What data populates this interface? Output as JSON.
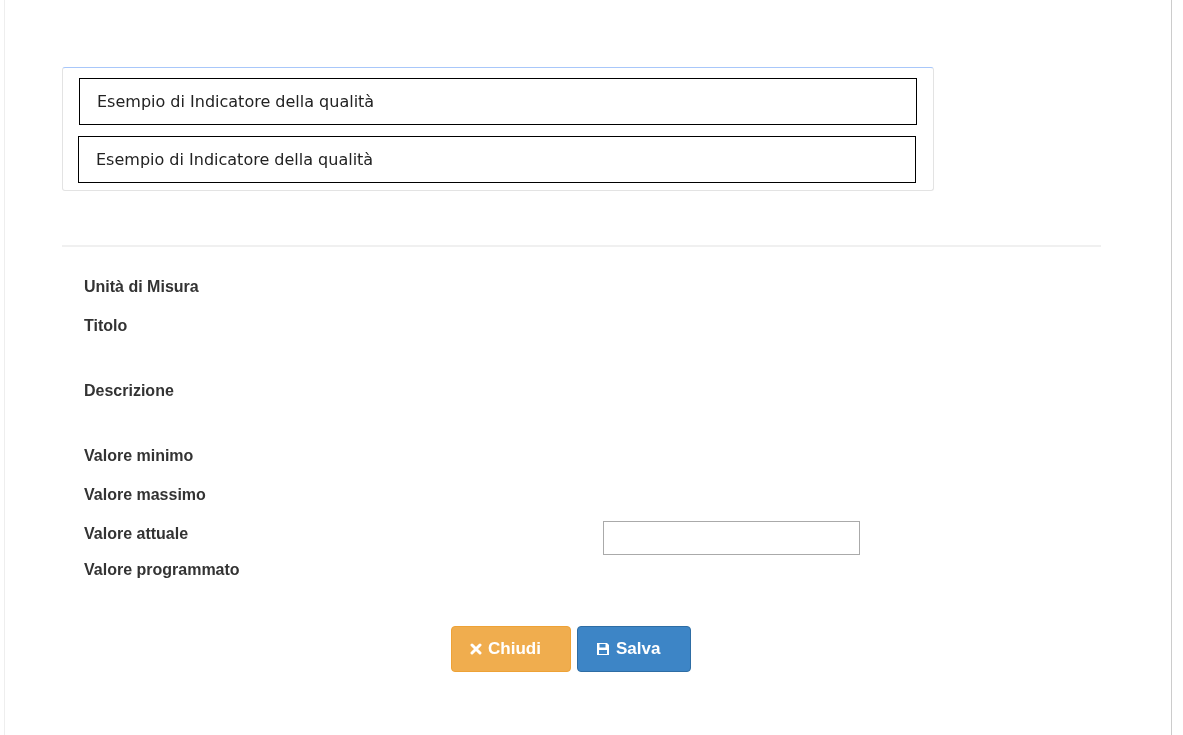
{
  "suggestions": [
    {
      "text": "Esempio di Indicatore della qualità"
    },
    {
      "text": "Esempio di Indicatore della qualità"
    }
  ],
  "fields": [
    {
      "label": "Unità di Misura",
      "input": false
    },
    {
      "label": "Titolo",
      "input": false
    },
    {
      "label": "Descrizione",
      "input": false
    },
    {
      "label": "Valore minimo",
      "input": false
    },
    {
      "label": "Valore massimo",
      "input": false
    },
    {
      "label": "Valore attuale",
      "input": true
    },
    {
      "label": "Valore programmato",
      "input": false
    }
  ],
  "buttons": [
    {
      "kind": "close",
      "label": "Chiudi"
    },
    {
      "kind": "save",
      "label": "Salva"
    }
  ]
}
